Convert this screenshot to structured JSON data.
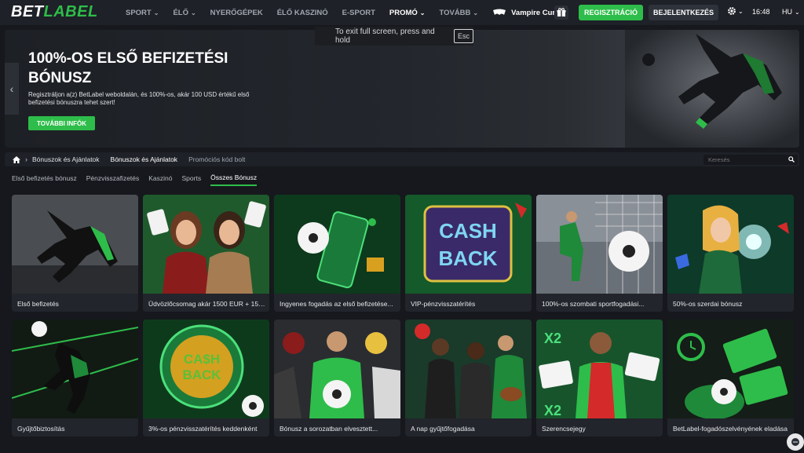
{
  "header": {
    "logo_bet": "BET",
    "logo_label": "LABEL",
    "nav": [
      {
        "label": "SPORT",
        "dropdown": true
      },
      {
        "label": "ÉLŐ",
        "dropdown": true
      },
      {
        "label": "NYERŐGÉPEK",
        "dropdown": false
      },
      {
        "label": "ÉLŐ KASZINÓ",
        "dropdown": false
      },
      {
        "label": "E-SPORT",
        "dropdown": false
      },
      {
        "label": "PROMÓ",
        "dropdown": true,
        "active": true
      },
      {
        "label": "TOVÁBB",
        "dropdown": true
      }
    ],
    "featured_game": "Vampire Curse",
    "register_label": "REGISZTRÁCIÓ",
    "login_label": "BEJELENTKEZÉS",
    "time": "16:48",
    "language": "HU"
  },
  "fullscreen_hint": {
    "text": "To exit full screen, press and hold",
    "key": "Esc"
  },
  "hero": {
    "title": "100%-OS ELSŐ BEFIZETÉSI BÓNUSZ",
    "description": "Regisztráljon a(z) BetLabel weboldalán, és 100%-os, akár 100 USD értékű első befizetési bónuszra tehet szert!",
    "button_label": "TOVÁBBI INFÓK"
  },
  "breadcrumb": {
    "items": [
      "Bónuszok és Ajánlatok",
      "Bónuszok és Ajánlatok",
      "Promóciós kód bolt"
    ]
  },
  "search": {
    "placeholder": "Keresés"
  },
  "filters": [
    {
      "label": "Első befizetés bónusz",
      "active": false
    },
    {
      "label": "Pénzvisszafizetés",
      "active": false
    },
    {
      "label": "Kaszinó",
      "active": false
    },
    {
      "label": "Sports",
      "active": false
    },
    {
      "label": "Összes Bónusz",
      "active": true
    }
  ],
  "cards": [
    {
      "label": "Első befizetés",
      "icon": "soccer-player-kick-image"
    },
    {
      "label": "Üdvözlőcsomag akár 1500 EUR + 150...",
      "icon": "casino-hostesses-image"
    },
    {
      "label": "Ingyenes fogadás az első befizetése...",
      "icon": "soccer-ball-field-image"
    },
    {
      "label": "VIP-pénzvisszatérítés",
      "icon": "cashback-sign-image"
    },
    {
      "label": "100%-os szombati sportfogadási...",
      "icon": "soccer-goal-image"
    },
    {
      "label": "50%-os szerdai bónusz",
      "icon": "casino-woman-image"
    },
    {
      "label": "Gyűjtőbiztosítás",
      "icon": "soccer-player-neon-image"
    },
    {
      "label": "3%-os pénzvisszatérítés keddenként",
      "icon": "cashback-coin-image"
    },
    {
      "label": "Bónusz a sorozatban elvesztett...",
      "icon": "sports-players-image"
    },
    {
      "label": "A nap gyűjtőfogadása",
      "icon": "athletes-image"
    },
    {
      "label": "Szerencsejegy",
      "icon": "fortune-ticket-image"
    },
    {
      "label": "BetLabel-fogadószelvényének eladása",
      "icon": "ticket-sale-image"
    }
  ],
  "colors": {
    "accent": "#2ebd4a",
    "background": "#16181d",
    "panel": "#1e2127"
  }
}
